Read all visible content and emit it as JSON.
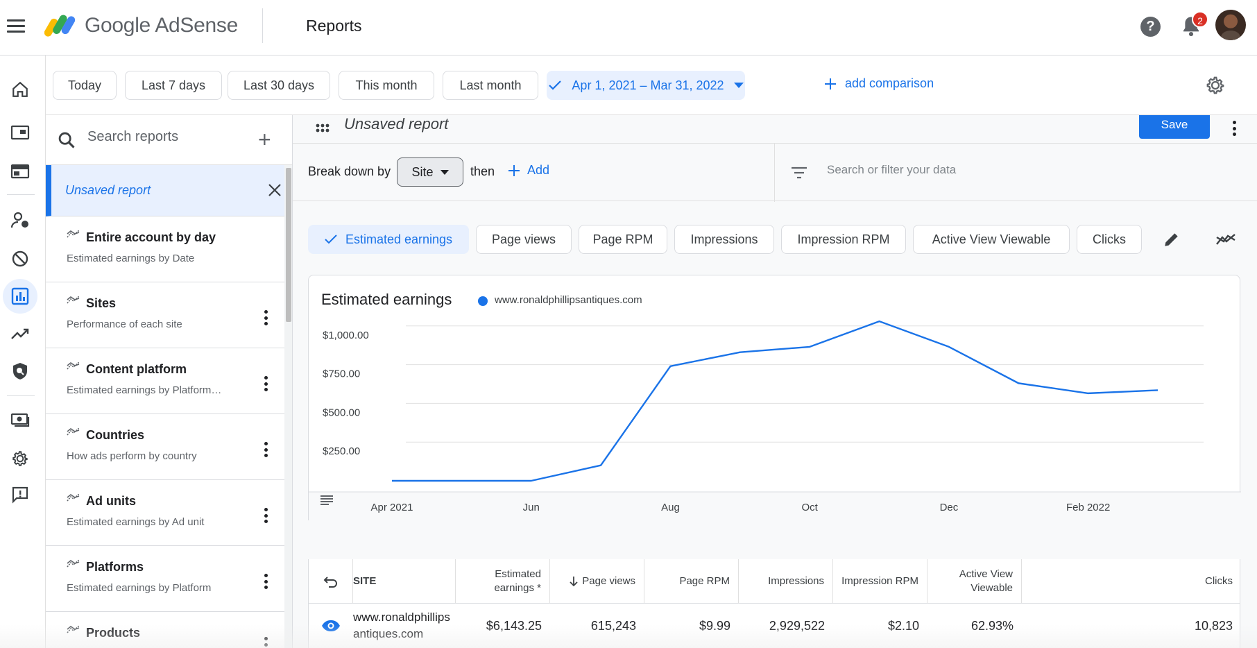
{
  "header": {
    "brand": "Google AdSense",
    "page_title": "Reports",
    "help_glyph": "?",
    "notification_count": "2"
  },
  "icons": {
    "menu": "menu-icon",
    "help": "help-icon",
    "notifications": "bell-icon",
    "settings": "gear-icon",
    "search": "search-icon",
    "filter": "filter-icon",
    "edit": "pencil-icon",
    "chart_toggle": "trend-icon",
    "view": "eye-icon"
  },
  "rail": {
    "items": [
      "home",
      "sites",
      "ads",
      "privacy-messaging",
      "blocking-controls",
      "reports",
      "optimization",
      "brand-safety",
      "payments",
      "account",
      "feedback"
    ],
    "active": "reports"
  },
  "date_ranges": {
    "today": "Today",
    "last7": "Last 7 days",
    "last30": "Last 30 days",
    "this_month": "This month",
    "last_month": "Last month",
    "selected_range": "Apr 1, 2021 – Mar 31, 2022",
    "add_comparison": "add comparison"
  },
  "reports_panel": {
    "search_placeholder": "Search reports",
    "new_report_glyph": "+",
    "unsaved_label": "Unsaved report",
    "items": [
      {
        "title": "Entire account by day",
        "subtitle": "Estimated earnings by Date"
      },
      {
        "title": "Sites",
        "subtitle": "Performance of each site"
      },
      {
        "title": "Content platform",
        "subtitle": "Estimated earnings by Platform…"
      },
      {
        "title": "Countries",
        "subtitle": "How ads perform by country"
      },
      {
        "title": "Ad units",
        "subtitle": "Estimated earnings by Ad unit"
      },
      {
        "title": "Platforms",
        "subtitle": "Estimated earnings by Platform"
      },
      {
        "title": "Products",
        "subtitle": ""
      }
    ]
  },
  "report": {
    "name": "Unsaved report",
    "save_label": "Save",
    "breakdown_label": "Break down by",
    "breakdown_value": "Site",
    "then_label": "then",
    "add_label": "Add",
    "filter_placeholder": "Search or filter your data"
  },
  "metrics": {
    "chips": [
      "Estimated earnings",
      "Page views",
      "Page RPM",
      "Impressions",
      "Impression RPM",
      "Active View Viewable",
      "Clicks"
    ],
    "selected": "Estimated earnings"
  },
  "chart": {
    "title": "Estimated earnings",
    "legend": "www.ronaldphillipsantiques.com",
    "color": "#1a73e8"
  },
  "chart_data": {
    "type": "line",
    "title": "Estimated earnings",
    "x": [
      "Apr 2021",
      "May 2021",
      "Jun 2021",
      "Jul 2021",
      "Aug 2021",
      "Sep 2021",
      "Oct 2021",
      "Nov 2021",
      "Dec 2021",
      "Jan 2022",
      "Feb 2022",
      "Mar 2022"
    ],
    "x_tick_labels": [
      "Apr 2021",
      "Jun",
      "Aug",
      "Oct",
      "Dec",
      "Feb 2022"
    ],
    "y_tick_labels": [
      "$1,000.00",
      "$750.00",
      "$500.00",
      "$250.00"
    ],
    "series": [
      {
        "name": "www.ronaldphillipsantiques.com",
        "values": [
          0,
          0,
          0,
          100,
          740,
          830,
          865,
          1030,
          865,
          630,
          565,
          585
        ]
      }
    ],
    "ylim": [
      0,
      1000
    ],
    "grid": true,
    "legend_placement": "top-left"
  },
  "table": {
    "headers": {
      "site": "SITE",
      "earnings_line1": "Estimated",
      "earnings_line2": "earnings *",
      "page_views": "Page views",
      "page_rpm": "Page RPM",
      "impressions": "Impressions",
      "impression_rpm": "Impression RPM",
      "active_view_line1": "Active View",
      "active_view_line2": "Viewable",
      "clicks": "Clicks"
    },
    "rows": [
      {
        "site_line1": "www.ronaldphillips",
        "site_line2": "antiques.com",
        "earnings": "$6,143.25",
        "page_views": "615,243",
        "page_rpm": "$9.99",
        "impressions": "2,929,522",
        "impression_rpm": "$2.10",
        "active_view": "62.93%",
        "clicks": "10,823"
      }
    ]
  }
}
